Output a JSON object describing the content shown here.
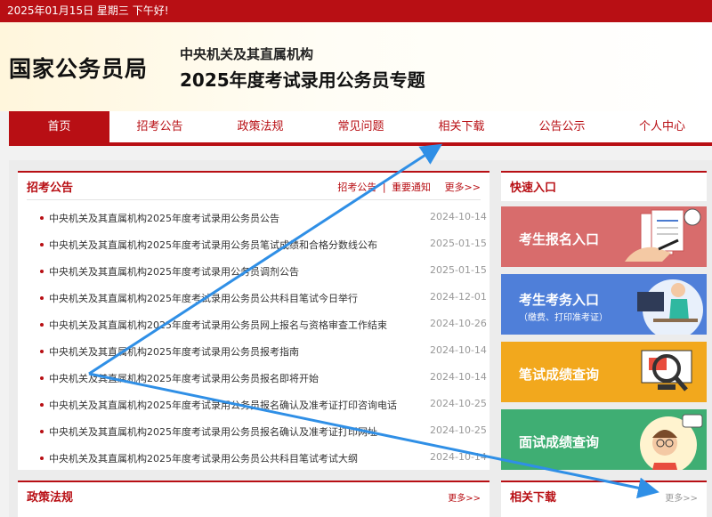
{
  "topbar": {
    "date_text": "2025年01月15日  星期三  下午好!"
  },
  "header": {
    "org_name": "国家公务员局",
    "subtitle1": "中央机关及其直属机构",
    "subtitle2": "2025年度考试录用公务员专题"
  },
  "nav": {
    "items": [
      {
        "label": "首页"
      },
      {
        "label": "招考公告"
      },
      {
        "label": "政策法规"
      },
      {
        "label": "常见问题"
      },
      {
        "label": "相关下载"
      },
      {
        "label": "公告公示"
      },
      {
        "label": "个人中心"
      }
    ],
    "active_index": 0
  },
  "announcements": {
    "title": "招考公告",
    "link1": "招考公告",
    "sep": "|",
    "link2": "重要通知",
    "more": "更多>>",
    "items": [
      {
        "title": "中央机关及其直属机构2025年度考试录用公务员公告",
        "date": "2024-10-14"
      },
      {
        "title": "中央机关及其直属机构2025年度考试录用公务员笔试成绩和合格分数线公布",
        "date": "2025-01-15"
      },
      {
        "title": "中央机关及其直属机构2025年度考试录用公务员调剂公告",
        "date": "2025-01-15"
      },
      {
        "title": "中央机关及其直属机构2025年度考试录用公务员公共科目笔试今日举行",
        "date": "2024-12-01"
      },
      {
        "title": "中央机关及其直属机构2025年度考试录用公务员网上报名与资格审查工作结束",
        "date": "2024-10-26"
      },
      {
        "title": "中央机关及其直属机构2025年度考试录用公务员报考指南",
        "date": "2024-10-14"
      },
      {
        "title": "中央机关及其直属机构2025年度考试录用公务员报名即将开始",
        "date": "2024-10-14"
      },
      {
        "title": "中央机关及其直属机构2025年度考试录用公务员报名确认及准考证打印咨询电话",
        "date": "2024-10-25"
      },
      {
        "title": "中央机关及其直属机构2025年度考试录用公务员报名确认及准考证打印网址",
        "date": "2024-10-25"
      },
      {
        "title": "中央机关及其直属机构2025年度考试录用公务员公共科目笔试考试大纲",
        "date": "2024-10-14"
      }
    ]
  },
  "quick": {
    "title": "快速入口",
    "tiles": [
      {
        "label": "考生报名入口",
        "sub": "",
        "color": "#d86c6c",
        "icon": "document-pen-icon"
      },
      {
        "label": "考生考务入口",
        "sub": "（缴费、打印准考证）",
        "color": "#4f7fd9",
        "icon": "computer-user-icon"
      },
      {
        "label": "笔试成绩查询",
        "sub": "",
        "color": "#f2a81d",
        "icon": "magnifier-computer-icon"
      },
      {
        "label": "面试成绩查询",
        "sub": "",
        "color": "#3fae73",
        "icon": "interview-person-icon"
      }
    ]
  },
  "policy": {
    "title": "政策法规",
    "more": "更多>>"
  },
  "downloads": {
    "title": "相关下载",
    "more": "更多>>"
  },
  "colors": {
    "brand_red": "#b80f14",
    "annotation_arrow": "#2f8fe6"
  }
}
